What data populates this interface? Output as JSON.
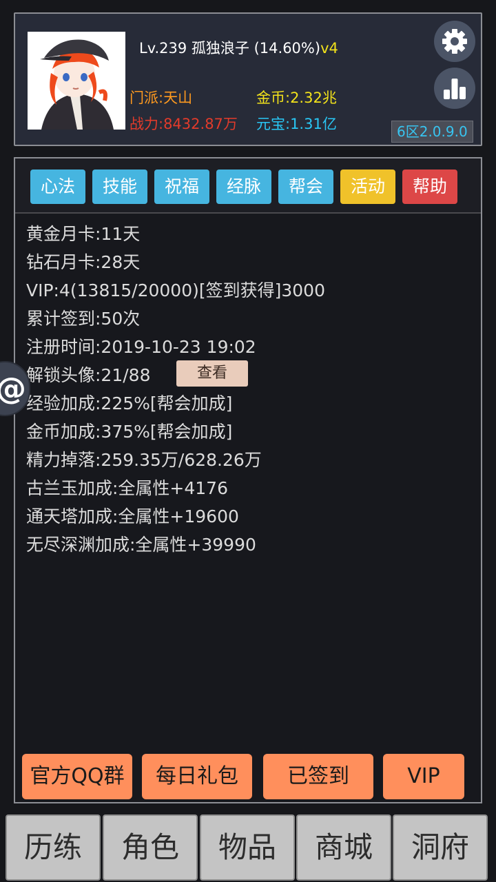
{
  "header": {
    "player_line": "Lv.239 孤独浪子 (14.60%)",
    "player_tag": "v4",
    "sect": "门派:天山",
    "gold": "金币:2.32兆",
    "power": "战力:8432.87万",
    "ingot": "元宝:1.31亿",
    "server": "6区2.0.9.0"
  },
  "tabs": [
    {
      "label": "心法",
      "color": "#46b5e0"
    },
    {
      "label": "技能",
      "color": "#46b5e0"
    },
    {
      "label": "祝福",
      "color": "#46b5e0"
    },
    {
      "label": "经脉",
      "color": "#46b5e0"
    },
    {
      "label": "帮会",
      "color": "#46b5e0"
    },
    {
      "label": "活动",
      "color": "#f0c22a"
    },
    {
      "label": "帮助",
      "color": "#dd4747"
    }
  ],
  "info": [
    "黄金月卡:11天",
    "钻石月卡:28天",
    "VIP:4(13815/20000)[签到获得]3000",
    "累计签到:50次",
    "注册时间:2019-10-23 19:02",
    "解锁头像:21/88",
    "经验加成:225%[帮会加成]",
    "金币加成:375%[帮会加成]",
    "精力掉落:259.35万/628.26万",
    "古兰玉加成:全属性+4176",
    "通天塔加成:全属性+19600",
    "无尽深渊加成:全属性+39990"
  ],
  "view_button": "查看",
  "actions": [
    "官方QQ群",
    "每日礼包",
    "已签到",
    "VIP"
  ],
  "float_button": "@",
  "nav": [
    "历练",
    "角色",
    "物品",
    "商城",
    "洞府"
  ]
}
